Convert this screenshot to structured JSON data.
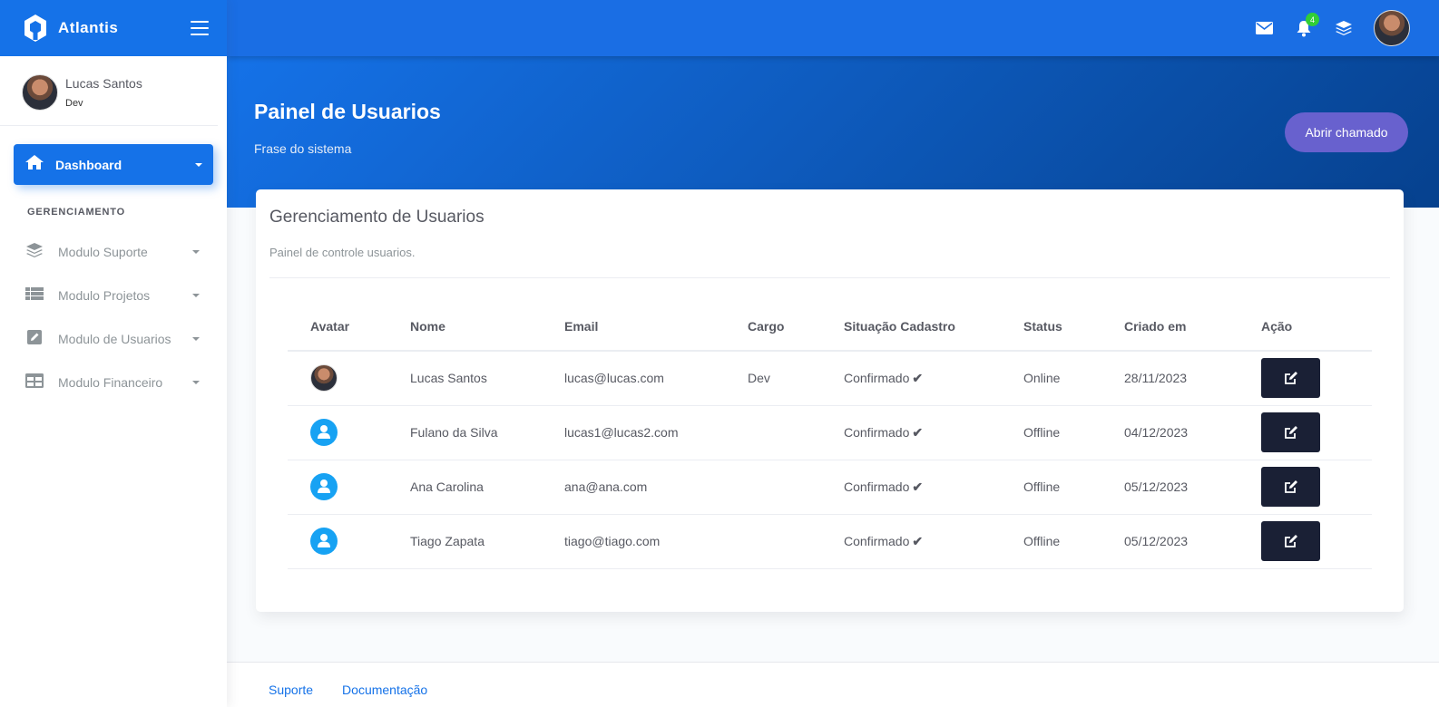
{
  "brand": {
    "name": "Atlantis",
    "color": "#1572e8"
  },
  "sidebar": {
    "user": {
      "name": "Lucas Santos",
      "role": "Dev"
    },
    "active_item": {
      "label": "Dashboard",
      "icon": "home-icon"
    },
    "section_title": "GERENCIAMENTO",
    "items": [
      {
        "label": "Modulo Suporte",
        "icon": "layers-icon"
      },
      {
        "label": "Modulo Projetos",
        "icon": "table-list-icon"
      },
      {
        "label": "Modulo de Usuarios",
        "icon": "pen-square-icon"
      },
      {
        "label": "Modulo Financeiro",
        "icon": "grid-icon"
      }
    ]
  },
  "topbar": {
    "notification_count": "4"
  },
  "panel": {
    "title": "Painel de Usuarios",
    "subtitle": "Frase do sistema",
    "button_label": "Abrir chamado"
  },
  "card": {
    "title": "Gerenciamento de Usuarios",
    "subtitle": "Painel de controle usuarios.",
    "columns": [
      "Avatar",
      "Nome",
      "Email",
      "Cargo",
      "Situação Cadastro",
      "Status",
      "Criado em",
      "Ação"
    ],
    "rows": [
      {
        "avatar": "photo",
        "name": "Lucas Santos",
        "email": "lucas@lucas.com",
        "role": "Dev",
        "registration": "Confirmado",
        "status": "Online",
        "created": "28/11/2023"
      },
      {
        "avatar": "placeholder",
        "name": "Fulano da Silva",
        "email": "lucas1@lucas2.com",
        "role": "",
        "registration": "Confirmado",
        "status": "Offline",
        "created": "04/12/2023"
      },
      {
        "avatar": "placeholder",
        "name": "Ana Carolina",
        "email": "ana@ana.com",
        "role": "",
        "registration": "Confirmado",
        "status": "Offline",
        "created": "05/12/2023"
      },
      {
        "avatar": "placeholder",
        "name": "Tiago Zapata",
        "email": "tiago@tiago.com",
        "role": "",
        "registration": "Confirmado",
        "status": "Offline",
        "created": "05/12/2023"
      }
    ]
  },
  "footer": {
    "links": [
      "Suporte",
      "Documentação"
    ]
  }
}
